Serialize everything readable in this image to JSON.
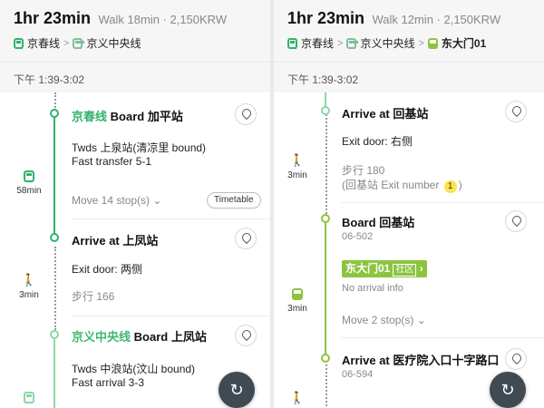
{
  "left": {
    "duration": "1hr 23min",
    "walk_info": "Walk 18min · 2,150KRW",
    "lines": [
      "京春线",
      "京义中央线"
    ],
    "time_range": "下午 1:39-3:02",
    "segments": [
      {
        "mode_icon": "subway-icon",
        "duration": "58min"
      },
      {
        "mode_icon": "walk-icon",
        "duration": "3min"
      }
    ],
    "steps": {
      "board1_line": "京春线",
      "board1_word": "Board",
      "board1_station": "加平站",
      "board1_direction": "Twds 上泉站(清凉里 bound)",
      "board1_transfer": "Fast transfer 5-1",
      "move_stops": "Move 14 stop(s)",
      "timetable": "Timetable",
      "arrive_word": "Arrive at",
      "arrive_station": "上凤站",
      "exit_door": "Exit door: 两侧",
      "walk": "步行 166",
      "board2_line": "京义中央线",
      "board2_word": "Board",
      "board2_station": "上凤站",
      "board2_direction": "Twds 中浪站(汶山 bound)",
      "board2_arrival": "Fast arrival 3-3"
    }
  },
  "right": {
    "duration": "1hr 23min",
    "walk_info": "Walk 12min · 2,150KRW",
    "lines": [
      "京春线",
      "京义中央线",
      "东大门01"
    ],
    "time_range": "下午 1:39-3:02",
    "segments": [
      {
        "mode_icon": "walk-icon",
        "duration": "3min"
      },
      {
        "mode_icon": "bus-icon",
        "duration": "3min"
      }
    ],
    "steps": {
      "arrive1_word": "Arrive at",
      "arrive1_station": "回基站",
      "exit_door": "Exit door: 右侧",
      "walk": "步行 180",
      "exit_prefix": "(回基站 Exit number",
      "exit_number": "1",
      "exit_suffix": ")",
      "board_word": "Board",
      "board_station": "回基站",
      "board_code": "06-502",
      "bus_name": "东大门01",
      "bus_tag": "社区",
      "no_arrival": "No arrival info",
      "move_stops": "Move 2 stop(s)",
      "arrive2_word": "Arrive at",
      "arrive2_station": "医疗院入口十字路口",
      "arrive2_code": "06-594"
    }
  },
  "colors": {
    "subway_green": "#2fb36a",
    "bus_green": "#8cc43f",
    "fab": "#3f4a52"
  }
}
